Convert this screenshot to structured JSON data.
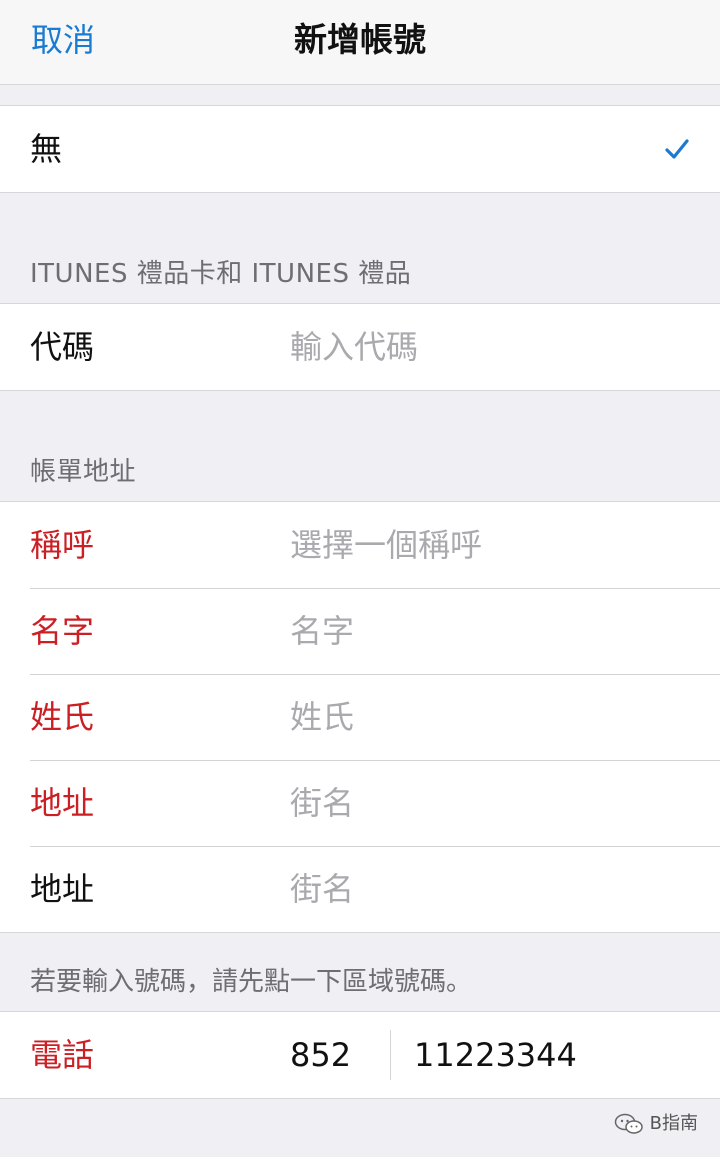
{
  "nav": {
    "cancel_label": "取消",
    "title": "新增帳號"
  },
  "payment": {
    "option_label": "無",
    "option_selected_icon": "checkmark-icon"
  },
  "itunes_section": {
    "header": "ITUNES 禮品卡和 ITUNES 禮品",
    "code_label": "代碼",
    "code_placeholder": "輸入代碼"
  },
  "billing_section": {
    "header": "帳單地址",
    "rows": [
      {
        "label": "稱呼",
        "placeholder": "選擇一個稱呼",
        "required": true
      },
      {
        "label": "名字",
        "placeholder": "名字",
        "required": true
      },
      {
        "label": "姓氏",
        "placeholder": "姓氏",
        "required": true
      },
      {
        "label": "地址",
        "placeholder": "街名",
        "required": true
      },
      {
        "label": "地址",
        "placeholder": "街名",
        "required": false
      }
    ],
    "phone_hint": "若要輸入號碼，請先點一下區域號碼。",
    "phone_label": "電話",
    "phone_area_code": "852",
    "phone_number": "11223344"
  },
  "colors": {
    "accent": "#1a7bd2",
    "required": "#cb1f24",
    "placeholder": "#a9a9ae",
    "background": "#efeff4"
  },
  "watermark": {
    "text": "B指南",
    "icon": "wechat-icon"
  }
}
